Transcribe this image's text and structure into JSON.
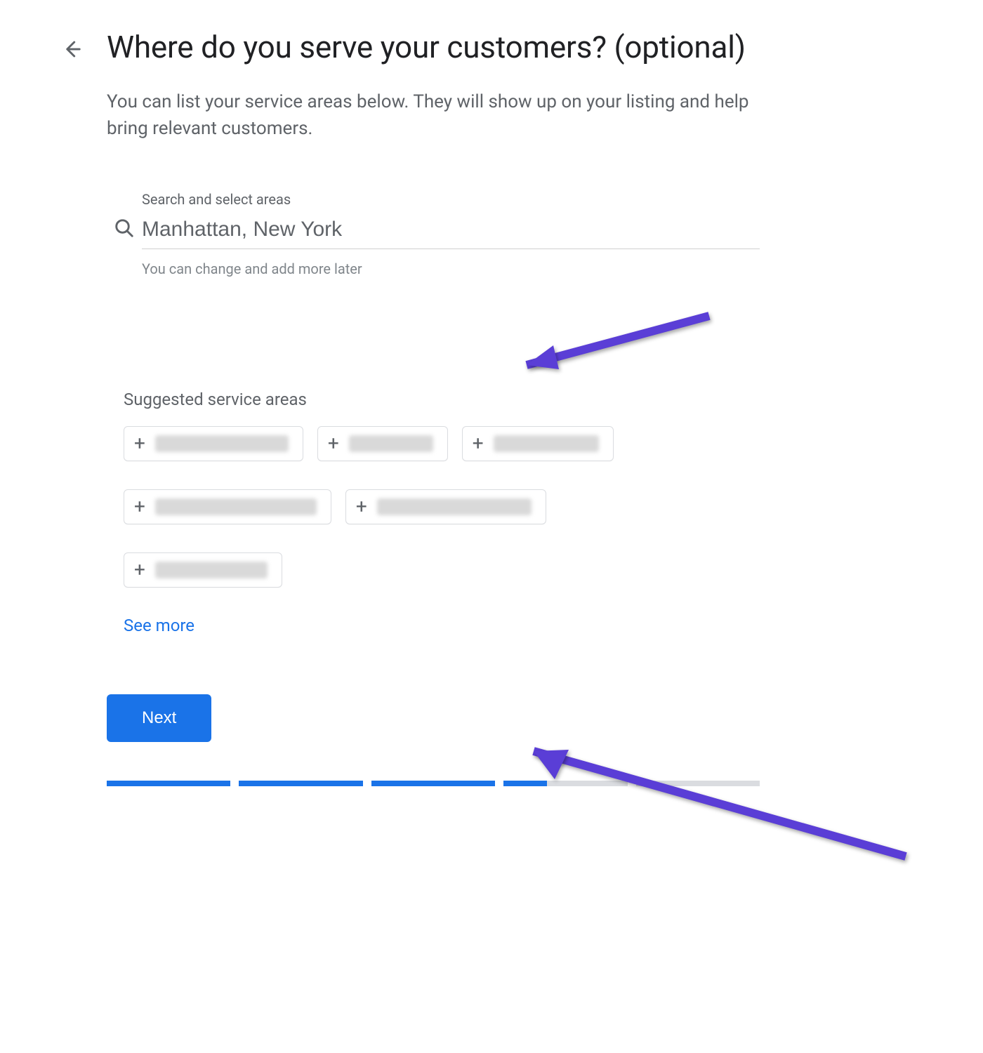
{
  "header": {
    "title": "Where do you serve your customers? (optional)",
    "subtitle": "You can list your service areas below. They will show up on your listing and help bring relevant customers."
  },
  "search": {
    "label": "Search and select areas",
    "value": "Manhattan, New York",
    "helper": "You can change and add more later"
  },
  "suggested": {
    "label": "Suggested service areas",
    "items": [
      {
        "blur_width": 190
      },
      {
        "blur_width": 120
      },
      {
        "blur_width": 150
      },
      {
        "blur_width": 230
      },
      {
        "blur_width": 220
      },
      {
        "blur_width": 160
      }
    ],
    "see_more": "See more"
  },
  "actions": {
    "next": "Next"
  },
  "progress": {
    "segments": [
      "filled",
      "filled",
      "filled",
      "partial",
      "empty"
    ]
  },
  "annotations": {
    "arrow1_target": "search-input",
    "arrow2_target": "suggested-chip"
  }
}
